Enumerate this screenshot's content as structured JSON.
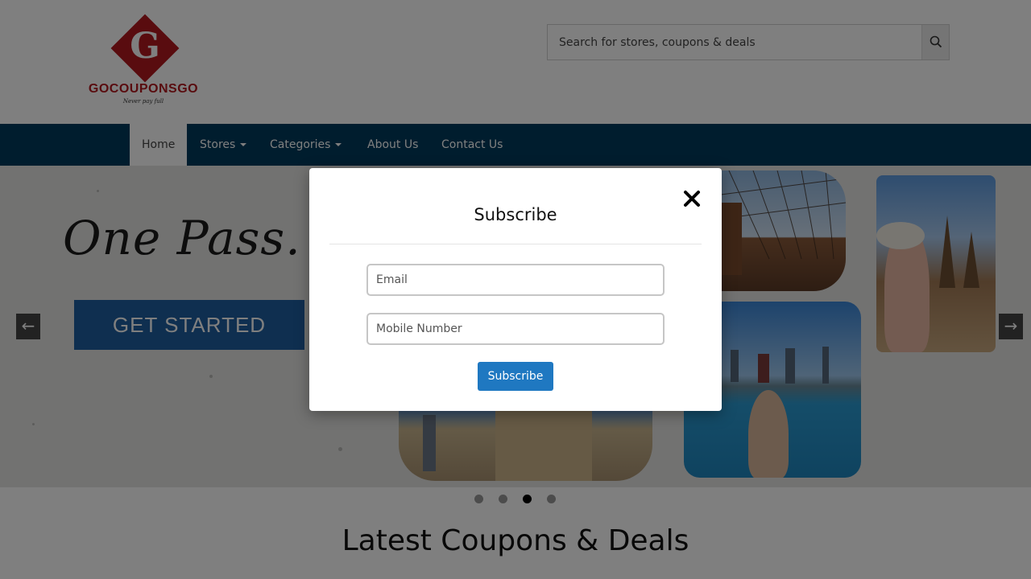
{
  "brand": {
    "logo_letter": "G",
    "name": "GOCOUPONSGO",
    "tagline": "Never pay full"
  },
  "search": {
    "placeholder": "Search for stores, coupons & deals"
  },
  "nav": {
    "items": [
      {
        "label": "Home",
        "active": true,
        "dropdown": false
      },
      {
        "label": "Stores",
        "active": false,
        "dropdown": true
      },
      {
        "label": "Categories",
        "active": false,
        "dropdown": true
      },
      {
        "label": "About Us",
        "active": false,
        "dropdown": false
      },
      {
        "label": "Contact Us",
        "active": false,
        "dropdown": false
      }
    ]
  },
  "hero": {
    "headline": "One Pass. All T",
    "cta_label": "GET STARTED",
    "prev_arrow": "←",
    "next_arrow": "→",
    "slides_count": 4,
    "active_slide": 3
  },
  "section": {
    "title": "Latest Coupons & Deals"
  },
  "modal": {
    "title": "Subscribe",
    "email_placeholder": "Email",
    "mobile_placeholder": "Mobile Number",
    "submit_label": "Subscribe"
  },
  "colors": {
    "brand_red": "#b3191f",
    "nav_bg": "#003a5c",
    "cta_blue": "#1f5fa0",
    "button_blue": "#1f78c1"
  }
}
